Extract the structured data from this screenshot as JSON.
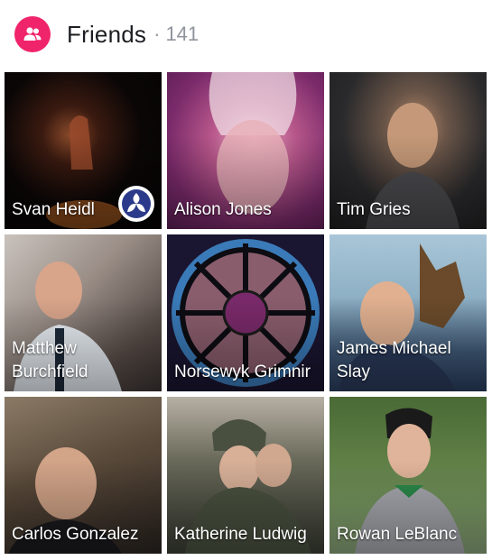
{
  "header": {
    "title": "Friends",
    "separator": "·",
    "count": "141",
    "icon": "friends-icon",
    "icon_color": "#f0246a"
  },
  "friends": [
    {
      "name": "Svan Heidl",
      "badge_icon": "triskelion-badge-icon"
    },
    {
      "name": "Alison Jones"
    },
    {
      "name": "Tim Gries"
    },
    {
      "name": "Matthew Burchfield"
    },
    {
      "name": "Norsewyk Grimnir"
    },
    {
      "name": "James Michael Slay"
    },
    {
      "name": "Carlos Gonzalez"
    },
    {
      "name": "Katherine Ludwig"
    },
    {
      "name": "Rowan LeBlanc"
    }
  ],
  "colors": {
    "title": "#1c1e21",
    "count": "#90949c",
    "name_text": "#ffffff"
  }
}
